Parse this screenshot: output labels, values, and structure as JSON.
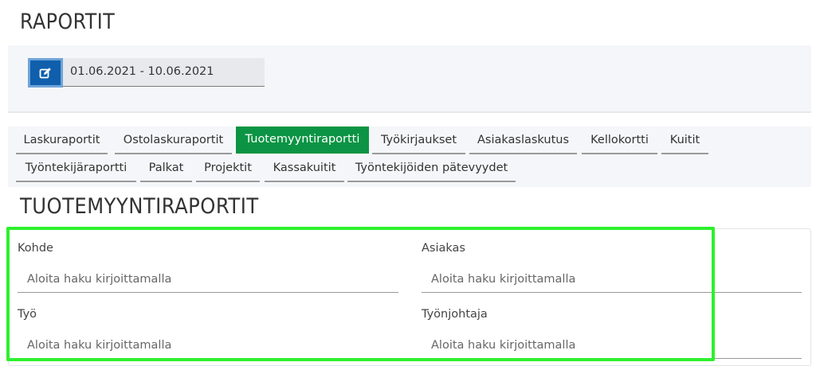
{
  "page": {
    "title": "RAPORTIT"
  },
  "date_filter": {
    "range": "01.06.2021 - 10.06.2021",
    "edit_icon": "edit-icon"
  },
  "tabs": [
    {
      "label": "Laskuraportit",
      "active": false
    },
    {
      "label": "Ostolaskuraportit",
      "active": false
    },
    {
      "label": "Tuotemyyntiraportti",
      "active": true
    },
    {
      "label": "Työkirjaukset",
      "active": false
    },
    {
      "label": "Asiakaslaskutus",
      "active": false
    },
    {
      "label": "Kellokortti",
      "active": false
    },
    {
      "label": "Kuitit",
      "active": false
    },
    {
      "label": "Työntekijäraportti",
      "active": false
    },
    {
      "label": "Palkat",
      "active": false
    },
    {
      "label": "Projektit",
      "active": false
    },
    {
      "label": "Kassakuitit",
      "active": false
    },
    {
      "label": "Työntekijöiden pätevyydet",
      "active": false
    }
  ],
  "section": {
    "title": "TUOTEMYYNTIRAPORTIT"
  },
  "filters": {
    "kohde": {
      "label": "Kohde",
      "placeholder": "Aloita haku kirjoittamalla",
      "value": ""
    },
    "asiakas": {
      "label": "Asiakas",
      "placeholder": "Aloita haku kirjoittamalla",
      "value": ""
    },
    "tyo": {
      "label": "Työ",
      "placeholder": "Aloita haku kirjoittamalla",
      "value": ""
    },
    "tyonjohtaja": {
      "label": "Työnjohtaja",
      "placeholder": "Aloita haku kirjoittamalla",
      "value": ""
    }
  },
  "colors": {
    "accent_blue": "#0f5fad",
    "active_tab": "#0b9444",
    "highlight": "#2ef02e",
    "panel_bg": "#f5f6f9"
  }
}
